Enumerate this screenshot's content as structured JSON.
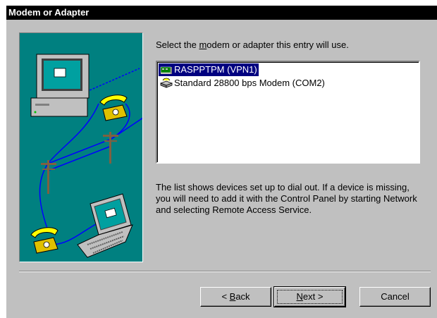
{
  "window": {
    "title": "Modem or Adapter"
  },
  "instruction": {
    "before": "Select the ",
    "mnemonic": "m",
    "after": "odem or adapter this entry will use."
  },
  "devices": [
    {
      "label": "RASPPTPM (VPN1)",
      "icon": "network-adapter-icon",
      "selected": true
    },
    {
      "label": "Standard 28800 bps Modem (COM2)",
      "icon": "modem-icon",
      "selected": false
    }
  ],
  "description": "The list shows devices set up to dial out.  If a device is missing, you will need to add it with the Control Panel by starting Network and selecting Remote Access Service.",
  "buttons": {
    "back": {
      "prefix": "< ",
      "mnemonic": "B",
      "rest": "ack"
    },
    "next": {
      "mnemonic": "N",
      "rest": "ext >"
    },
    "cancel": "Cancel"
  },
  "colors": {
    "face": "#c0c0c0",
    "illustration_bg": "#008080",
    "selection": "#000080",
    "titlebar": "#000000"
  }
}
